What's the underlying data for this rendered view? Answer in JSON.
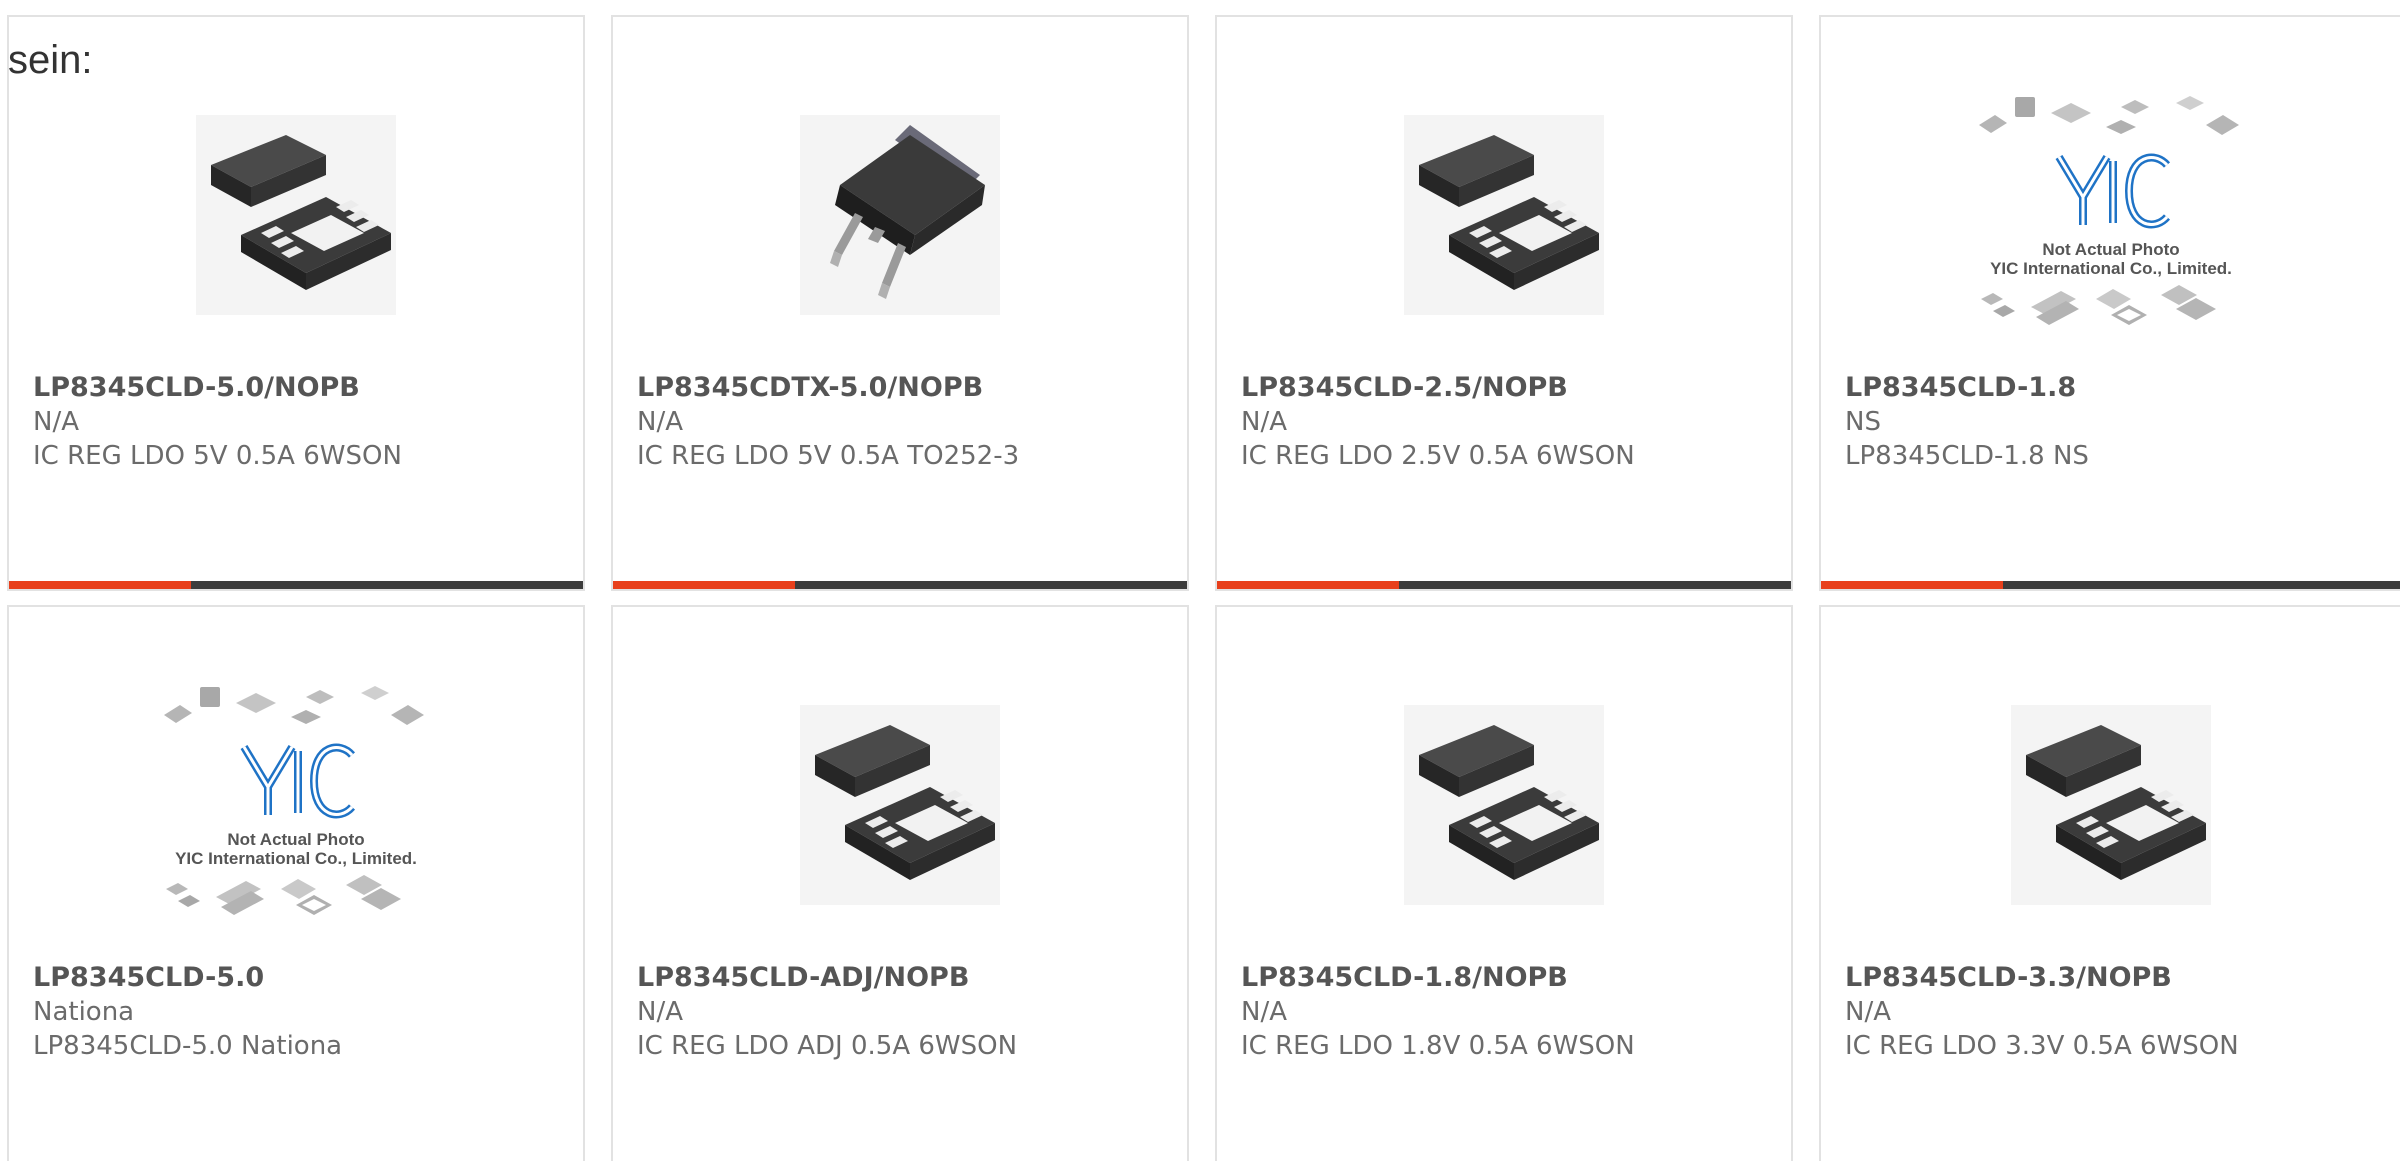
{
  "intro_text": "sein:",
  "colors": {
    "accent": "#e8401c",
    "bar": "#3c3c3c",
    "border": "#e2e2e2",
    "text": "#6b6b6b",
    "logo_blue": "#1f73c6"
  },
  "cards": [
    {
      "title": "LP8345CLD-5.0/NOPB",
      "manufacturer": "N/A",
      "description": "IC REG LDO 5V 0.5A 6WSON",
      "image": "wson-package-icon"
    },
    {
      "title": "LP8345CDTX-5.0/NOPB",
      "manufacturer": "N/A",
      "description": "IC REG LDO 5V 0.5A TO252-3",
      "image": "to252-package-icon"
    },
    {
      "title": "LP8345CLD-2.5/NOPB",
      "manufacturer": "N/A",
      "description": "IC REG LDO 2.5V 0.5A 6WSON",
      "image": "wson-package-icon"
    },
    {
      "title": "LP8345CLD-1.8",
      "manufacturer": "NS",
      "description": "LP8345CLD-1.8 NS",
      "image": "yic-placeholder-image",
      "placeholder_line1": "Not Actual Photo",
      "placeholder_line2": "YIC International Co., Limited."
    },
    {
      "title": "LP8345CLD-5.0",
      "manufacturer": "Nationa",
      "description": "LP8345CLD-5.0 Nationa",
      "image": "yic-placeholder-image",
      "placeholder_line1": "Not Actual Photo",
      "placeholder_line2": "YIC International Co., Limited."
    },
    {
      "title": "LP8345CLD-ADJ/NOPB",
      "manufacturer": "N/A",
      "description": "IC REG LDO ADJ 0.5A 6WSON",
      "image": "wson-package-icon"
    },
    {
      "title": "LP8345CLD-1.8/NOPB",
      "manufacturer": "N/A",
      "description": "IC REG LDO 1.8V 0.5A 6WSON",
      "image": "wson-package-icon"
    },
    {
      "title": "LP8345CLD-3.3/NOPB",
      "manufacturer": "N/A",
      "description": "IC REG LDO 3.3V 0.5A 6WSON",
      "image": "wson-package-icon"
    }
  ]
}
